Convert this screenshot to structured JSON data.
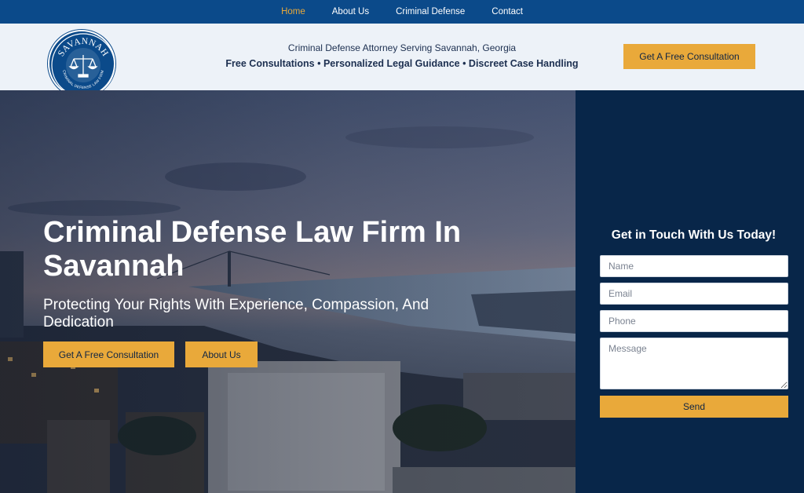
{
  "nav": {
    "items": [
      {
        "label": "Home",
        "active": true
      },
      {
        "label": "About Us",
        "active": false
      },
      {
        "label": "Criminal Defense",
        "active": false
      },
      {
        "label": "Contact",
        "active": false
      }
    ]
  },
  "header": {
    "logo": {
      "brand": "SAVANNAH",
      "subtext": "CRIMINAL DEFENSE LAW FIRM",
      "icon": "scales-of-justice-icon"
    },
    "tagline": "Criminal Defense Attorney Serving Savannah, Georgia",
    "features": "Free Consultations • Personalized Legal Guidance • Discreet Case Handling",
    "cta_label": "Get A Free Consultation"
  },
  "hero": {
    "title": "Criminal Defense Law Firm In Savannah",
    "subtitle": "Protecting Your Rights With Experience, Compassion, And Dedication",
    "primary_button": "Get A Free Consultation",
    "secondary_button": "About Us"
  },
  "contact_form": {
    "title": "Get in Touch With Us Today!",
    "name_placeholder": "Name",
    "email_placeholder": "Email",
    "phone_placeholder": "Phone",
    "message_placeholder": "Message",
    "send_label": "Send"
  },
  "colors": {
    "nav_bg": "#0b4a8a",
    "accent": "#e9a93a",
    "panel_bg": "#082649",
    "header_bg": "#edf2f8"
  }
}
